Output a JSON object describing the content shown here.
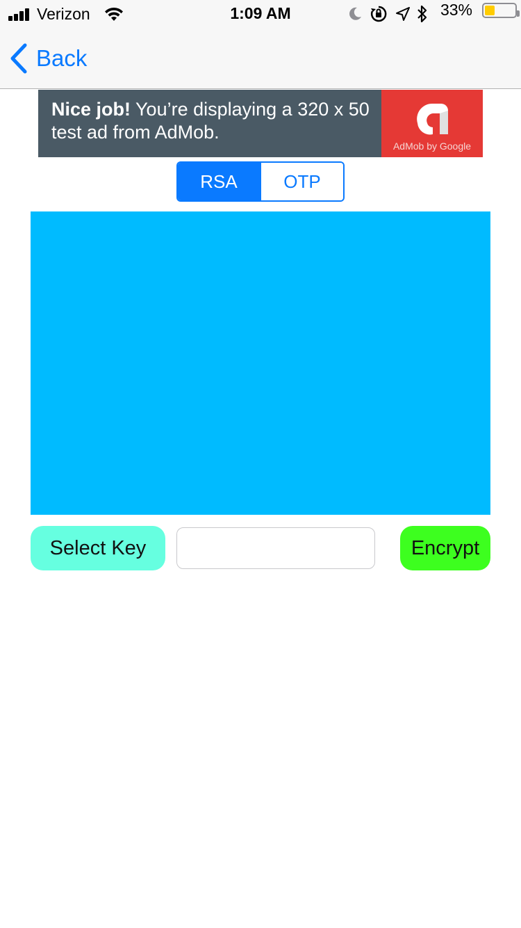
{
  "status_bar": {
    "carrier": "Verizon",
    "time": "1:09 AM",
    "battery_percent": "33%",
    "battery_level": 0.33,
    "battery_color": "#ffcc00",
    "icons": [
      "signal-icon",
      "wifi-icon",
      "moon-icon",
      "orientation-lock-icon",
      "location-icon",
      "bluetooth-icon",
      "battery-icon"
    ]
  },
  "nav": {
    "back_label": "Back",
    "accent_color": "#0a7aff"
  },
  "ad": {
    "headline_bold": "Nice job!",
    "headline_rest": " You’re displaying a 320 x 50 test ad from AdMob.",
    "logo_caption": "AdMob by Google",
    "background_color": "#4a5a65",
    "logo_color": "#e53935"
  },
  "segmented": {
    "segments": [
      "RSA",
      "OTP"
    ],
    "selected": "RSA"
  },
  "content_area": {
    "color": "#00bbff"
  },
  "actions": {
    "select_key_label": "Select Key",
    "select_key_color": "#66ffe0",
    "key_field_value": "",
    "key_field_placeholder": "",
    "encrypt_label": "Encrypt",
    "encrypt_color": "#3dff1f"
  }
}
